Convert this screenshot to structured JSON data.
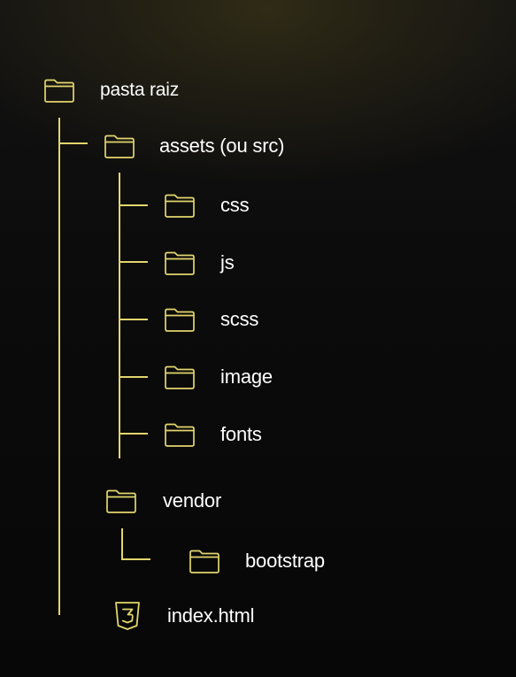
{
  "colors": {
    "accent": "#e2d66c",
    "text": "#ffffff",
    "background": "#0b0b0b"
  },
  "tree": {
    "root": {
      "label": "pasta raiz",
      "icon": "folder-icon"
    },
    "assets": {
      "label": "assets (ou src)",
      "icon": "folder-icon",
      "children": [
        {
          "label": "css",
          "icon": "folder-icon"
        },
        {
          "label": "js",
          "icon": "folder-icon"
        },
        {
          "label": "scss",
          "icon": "folder-icon"
        },
        {
          "label": "image",
          "icon": "folder-icon"
        },
        {
          "label": "fonts",
          "icon": "folder-icon"
        }
      ]
    },
    "vendor": {
      "label": "vendor",
      "icon": "folder-icon",
      "children": [
        {
          "label": "bootstrap",
          "icon": "folder-icon"
        }
      ]
    },
    "index": {
      "label": "index.html",
      "icon": "html5-icon"
    }
  }
}
